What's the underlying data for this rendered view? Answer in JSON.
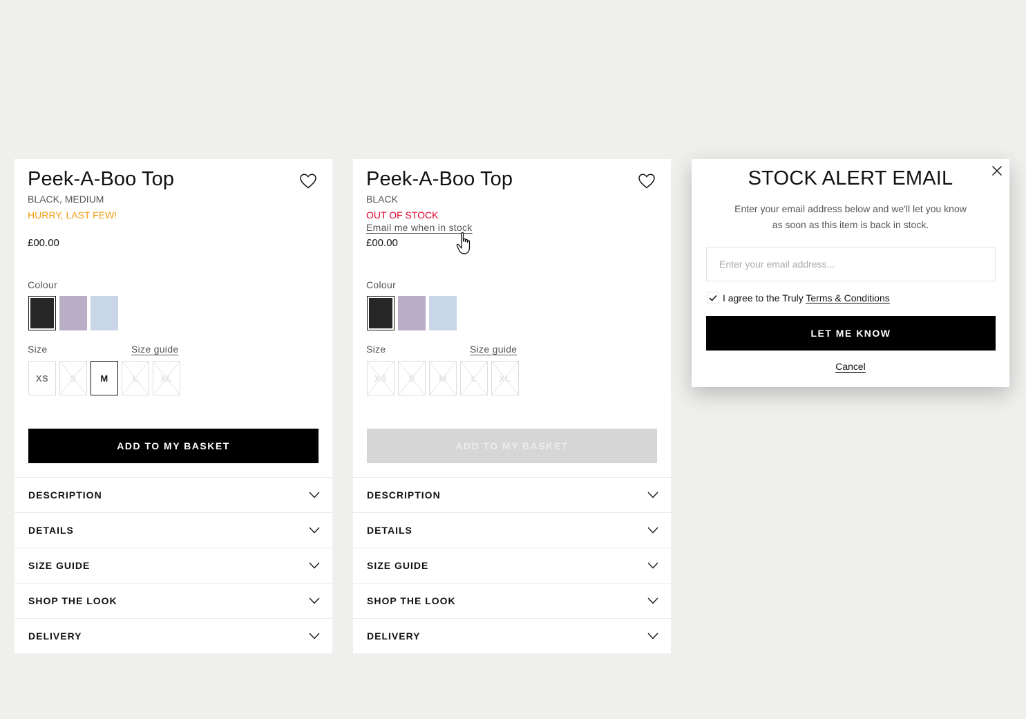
{
  "card1": {
    "title": "Peek-A-Boo Top",
    "variant": "BLACK, MEDIUM",
    "stock_status": "HURRY, LAST FEW!",
    "price": "£00.00",
    "colour_label": "Colour",
    "colours": [
      {
        "name": "black",
        "hex": "#262626",
        "selected": true
      },
      {
        "name": "lilac",
        "hex": "#b9aec6",
        "selected": false
      },
      {
        "name": "light-blue",
        "hex": "#c8d6e7",
        "selected": false
      }
    ],
    "size_label": "Size",
    "size_guide_link": "Size guide",
    "sizes": [
      {
        "label": "XS",
        "state": "available"
      },
      {
        "label": "S",
        "state": "unavailable"
      },
      {
        "label": "M",
        "state": "selected"
      },
      {
        "label": "L",
        "state": "unavailable"
      },
      {
        "label": "XL",
        "state": "unavailable"
      }
    ],
    "basket_button": "ADD TO MY BASKET",
    "accordion": [
      "DESCRIPTION",
      "DETAILS",
      "SIZE GUIDE",
      "SHOP THE LOOK",
      "DELIVERY"
    ]
  },
  "card2": {
    "title": "Peek-A-Boo Top",
    "variant": "BLACK",
    "stock_status": "OUT OF STOCK",
    "email_link": "Email me when in stock",
    "price": "£00.00",
    "colour_label": "Colour",
    "colours": [
      {
        "name": "black",
        "hex": "#262626",
        "selected": true
      },
      {
        "name": "lilac",
        "hex": "#b9aec6",
        "selected": false
      },
      {
        "name": "light-blue",
        "hex": "#c8d6e7",
        "selected": false
      }
    ],
    "size_label": "Size",
    "size_guide_link": "Size guide",
    "sizes": [
      {
        "label": "XS",
        "state": "unavailable"
      },
      {
        "label": "S",
        "state": "unavailable"
      },
      {
        "label": "M",
        "state": "unavailable"
      },
      {
        "label": "L",
        "state": "unavailable"
      },
      {
        "label": "XL",
        "state": "unavailable"
      }
    ],
    "basket_button": "ADD TO MY BASKET",
    "basket_disabled": true,
    "accordion": [
      "DESCRIPTION",
      "DETAILS",
      "SIZE GUIDE",
      "SHOP THE LOOK",
      "DELIVERY"
    ]
  },
  "modal": {
    "title": "STOCK ALERT EMAIL",
    "text_line1": "Enter your email address below and we'll let you know",
    "text_line2": "as soon as this item is back in stock.",
    "email_placeholder": "Enter your email address...",
    "agree_text": "I agree to the Truly ",
    "terms_link": "Terms & Conditions",
    "agree_checked": true,
    "submit_button": "LET ME KNOW",
    "cancel_link": "Cancel"
  },
  "colors": {
    "low_stock": "#f29b12",
    "out_of_stock": "#e4002b",
    "primary_button": "#000000",
    "disabled_button": "#d6d6d6",
    "page_background": "#efefed"
  },
  "icons": [
    "heart-icon",
    "chevron-down-icon",
    "close-icon",
    "checkmark-icon",
    "hand-pointer-cursor-icon"
  ]
}
